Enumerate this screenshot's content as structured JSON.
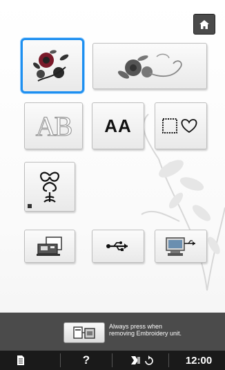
{
  "header": {
    "home_icon": "home-icon"
  },
  "tiles": {
    "row1": [
      "floral-embroidery-design-icon",
      "floral-border-design-icon"
    ],
    "row2_alphabet_letters": "AB",
    "row2_character_letters": "AA",
    "row2_frame_icons": "frame-heart-icon",
    "row3": "decorative-ornament-icon",
    "row4": [
      "memory-card-machine-icon",
      "usb-icon",
      "computer-usb-icon"
    ]
  },
  "bottom": {
    "button_icon": "embroidery-unit-release-icon",
    "note_line1": "Always press when",
    "note_line2": "removing Embroidery unit."
  },
  "status": {
    "doc_icon": "document-icon",
    "help_label": "?",
    "settings_icon": "thread-change-icon",
    "time": "12:00"
  },
  "colors": {
    "selection": "#1d8ff0",
    "bar": "#4b4b4b",
    "status_bar": "#1a1a1a"
  }
}
